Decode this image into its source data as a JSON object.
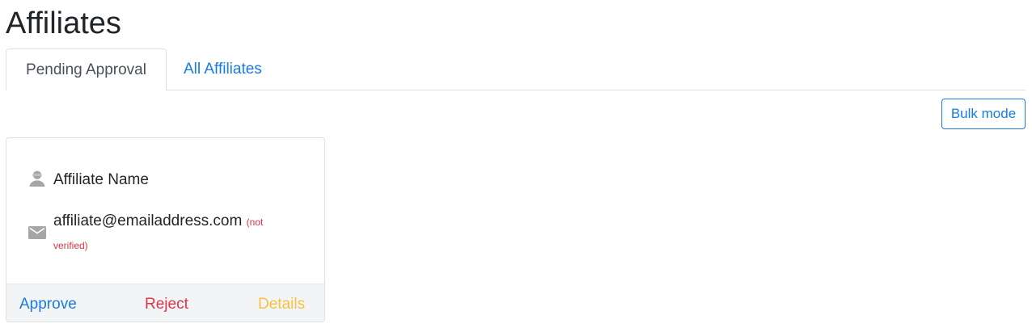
{
  "page": {
    "title": "Affiliates"
  },
  "tabs": [
    {
      "label": "Pending Approval",
      "active": true
    },
    {
      "label": "All Affiliates",
      "active": false
    }
  ],
  "toolbar": {
    "bulk_mode_label": "Bulk mode"
  },
  "affiliate_card": {
    "name": "Affiliate Name",
    "email": "affiliate@emailaddress.com",
    "email_status": "(not verified)",
    "icons": {
      "name": "user-icon",
      "email": "mail-icon"
    },
    "actions": {
      "approve": "Approve",
      "reject": "Reject",
      "details": "Details"
    }
  },
  "colors": {
    "link_blue": "#1a7be0",
    "danger_red": "#dc3545",
    "warning_yellow": "#f5c242",
    "icon_gray": "#a6a6a6"
  }
}
